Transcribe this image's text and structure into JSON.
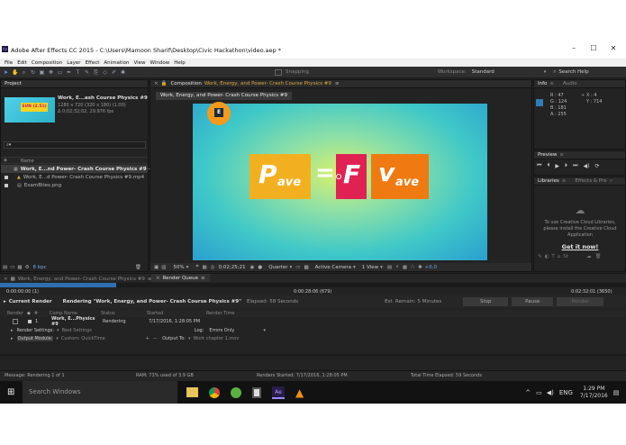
{
  "window": {
    "title": "Adobe After Effects CC 2015 - C:\\Users\\Mamoon Sharif\\Desktop\\Civic Hackathon\\video.aep *",
    "minimize": "–",
    "maximize": "☐",
    "close": "✕"
  },
  "menu": [
    "File",
    "Edit",
    "Composition",
    "Layer",
    "Effect",
    "Animation",
    "View",
    "Window",
    "Help"
  ],
  "toolbar": {
    "snapping": "Snapping",
    "workspace_label": "Workspace:",
    "workspace_value": "Standard",
    "search_help": "Search Help"
  },
  "project": {
    "tab": "Project",
    "thumb_text": "SUN (2.51)",
    "item_name": "Work, E...ash Course Physics #9 ▾",
    "item_res": "1280 x 720  (320 x 180) (1.00)",
    "item_duration": "Δ 0;02;32;02, 29.976 fps",
    "search_placeholder": "⌕▾",
    "col_name": "Name",
    "files": [
      {
        "name": "Work, E...nd Power- Crash Course Physics #9",
        "type": "comp",
        "selected": true
      },
      {
        "name": "Work, E...d Power- Crash Course Physics #9.mp4",
        "type": "footage",
        "selected": false
      },
      {
        "name": "ExamBites.png",
        "type": "image",
        "selected": false
      }
    ],
    "bpc": "8 bpc"
  },
  "comp": {
    "tab_prefix": "Composition",
    "tab_name": "Work, Energy, and Power- Crash Course Physics #9",
    "subtab": "Work, Energy, and Power- Crash Course Physics #9",
    "formula": {
      "left_main": "P",
      "left_sub": "ave",
      "eq": "=",
      "mid": "F",
      "right_main": "v",
      "right_sub": "ave"
    },
    "zoom": "50%",
    "timecode": "0;02;25;21",
    "resolution": "Quarter",
    "camera": "Active Camera",
    "view": "1 View",
    "exposure": "+0.0"
  },
  "info": {
    "tab_info": "Info",
    "tab_audio": "Audio",
    "r": "R : 47",
    "g": "G : 124",
    "b": "B : 181",
    "a": "A : 255",
    "x": "X : 4",
    "y": "Y : 714",
    "swatch": "#2f7cb5"
  },
  "preview": {
    "tab": "Preview"
  },
  "libraries": {
    "tab": "Libraries",
    "tab2": "Effects & Pre",
    "message": "To use Creative Cloud Libraries, please install the Creative Cloud Application",
    "link": "Get it now!"
  },
  "timeline": {
    "tab1": "Work, Energy, and Power- Crash Course Physics #9",
    "tab2": "Render Queue",
    "t_start": "0:00:00:00 (1)",
    "t_mid": "0:00:28:06 (679)",
    "t_end": "0:02:32:01 (3650)",
    "progress": 0.185
  },
  "render": {
    "current_label": "Current Render",
    "rendering_text": "Rendering \"Work, Energy, and Power- Crash Course Physics #9\"",
    "elapsed": "Elapsed: 58 Seconds",
    "remain": "Est. Remain: 5 Minutes",
    "stop": "Stop",
    "pause": "Pause",
    "render_btn": "Render",
    "cols": [
      "Render",
      "#",
      "Comp Name",
      "Status",
      "Started",
      "Render Time"
    ],
    "item": {
      "num": "1",
      "comp": "Work, E...Physics #9",
      "status": "Rendering",
      "started": "7/17/2016, 1:28:05 PM"
    },
    "settings_label": "Render Settings:",
    "settings_value": "Best Settings",
    "log_label": "Log:",
    "log_value": "Errors Only",
    "output_module_label": "Output Module:",
    "output_module_value": "Custom: QuickTime",
    "output_to_label": "Output To:",
    "output_to_value": "Work chapter 1.mov"
  },
  "statusbar": {
    "message": "Message: Rendering 1 of 1",
    "ram": "RAM: 73% used of 3.9 GB",
    "started": "Renders Started: 7/17/2016, 1:28:05 PM",
    "total": "Total Time Elapsed: 59 Seconds"
  },
  "taskbar": {
    "search": "Search Windows",
    "lang": "ENG",
    "time": "1:29 PM",
    "date": "7/17/2016"
  },
  "colors": {
    "accent_blue": "#2d5b86",
    "formula_yellow": "#f2b021",
    "formula_red": "#e02253",
    "formula_orange": "#f07a12"
  }
}
